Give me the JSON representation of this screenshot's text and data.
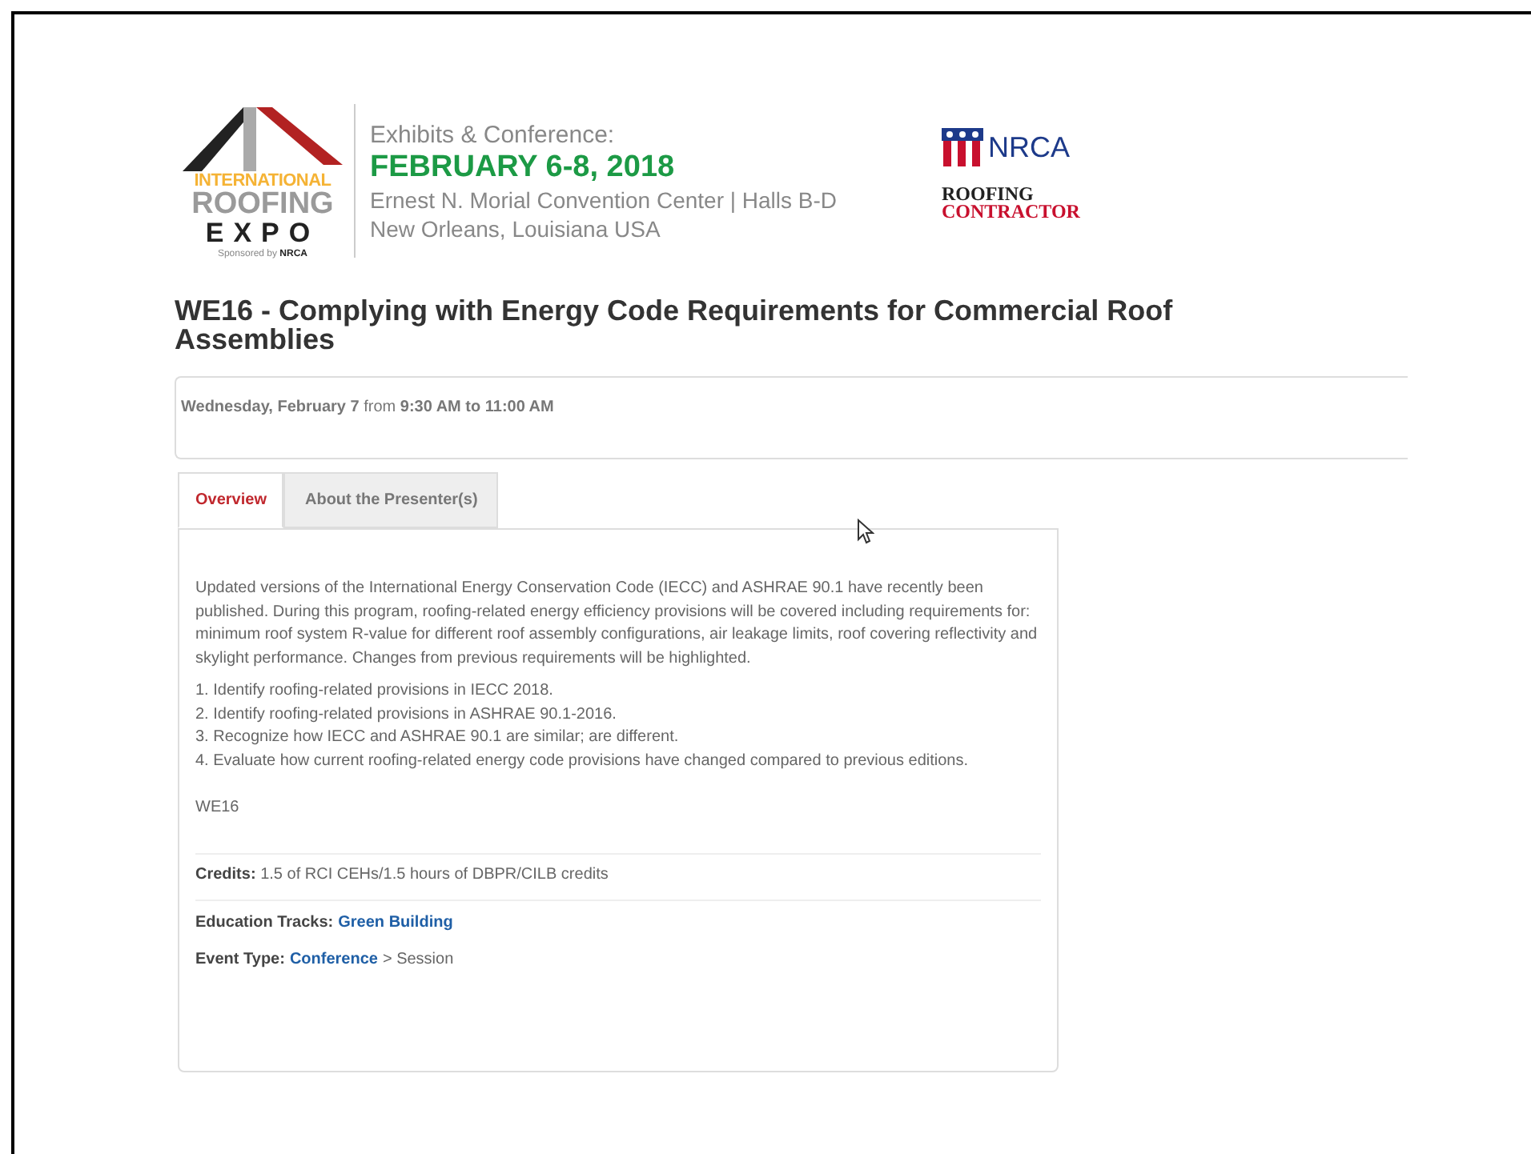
{
  "logo": {
    "line_1": "INTERNATIONAL",
    "line_2": "ROOFING",
    "line_3": "EXPO",
    "sponsor": "Sponsored by",
    "sponsor_name": "NRCA"
  },
  "event_info": {
    "heading": "Exhibits & Conference:",
    "dates": "FEBRUARY 6-8, 2018",
    "venue": "Ernest N. Morial Convention Center | Halls B-D",
    "city": "New Orleans, Louisiana USA"
  },
  "partners": [
    {
      "kind": "nrca",
      "name": "NRCA"
    },
    {
      "kind": "magazine",
      "line_1": "ROOFING",
      "line_2": "CONTRACTOR"
    }
  ],
  "title": "WE16 - Complying with Energy Code Requirements for Commercial Roof Assemblies",
  "schedule": "**Wednesday, February 7** from **9:30 AM to 11:00 AM**",
  "tabs": [
    {
      "label": "Overview",
      "selected": true
    },
    {
      "label": "About the Presenter(s)",
      "selected": false
    }
  ],
  "overview": {
    "description": "Updated versions of the International Energy Conservation Code (IECC) and ASHRAE 90.1 have recently been published.  During this program, roofing-related energy efficiency provisions will be covered including requirements for: minimum roof system R-value for different roof assembly configurations, air leakage limits, roof covering reflectivity and skylight performance.  Changes from previous requirements will be highlighted.",
    "objectives": [
      "1. Identify roofing-related provisions in IECC 2018.",
      "2. Identify roofing-related provisions in ASHRAE 90.1-2016.",
      "3. Recognize how IECC and ASHRAE 90.1 are similar; are different.",
      "4. Evaluate how current roofing-related energy code provisions have changed compared to previous editions."
    ],
    "code": "WE16",
    "credits": {
      "label": "Credits:",
      "value": "1.5 of RCI CEHs/1.5 hours of DBPR/CILB credits"
    },
    "education_tracks": {
      "label": "Education Tracks:",
      "link": "Green Building"
    },
    "event_type": {
      "label": "Event Type:",
      "link": "Conference",
      "rest": "> Session"
    }
  }
}
